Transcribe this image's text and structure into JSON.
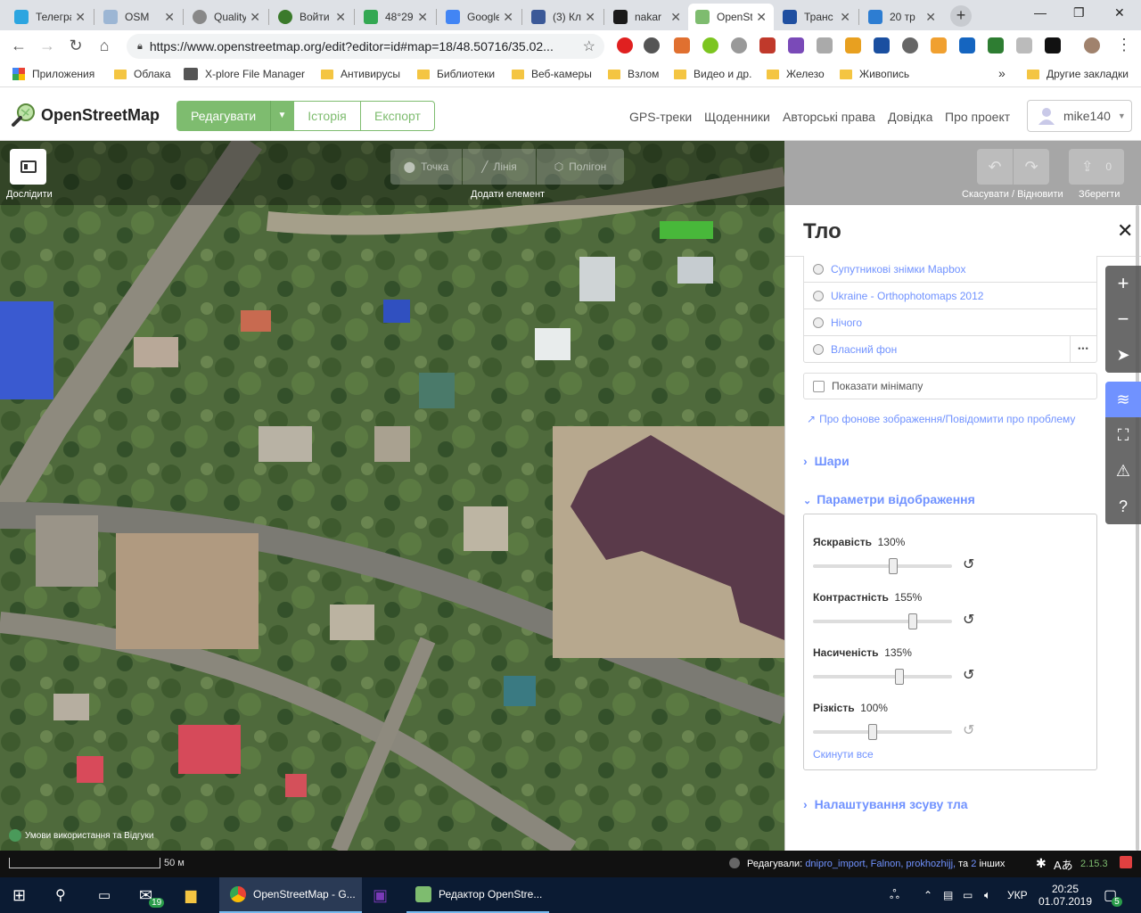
{
  "browser": {
    "tabs": [
      {
        "title": "Телеграм",
        "color": "#2ca5e0"
      },
      {
        "title": "OSM",
        "color": "#7ebc6f"
      },
      {
        "title": "Quality",
        "color": "#888888"
      },
      {
        "title": "Войти",
        "color": "#3b7a2b"
      },
      {
        "title": "48°29",
        "color": "#34a853"
      },
      {
        "title": "Google",
        "color": "#4285f4"
      },
      {
        "title": "(3) Кл",
        "color": "#3b5998"
      },
      {
        "title": "nakar",
        "color": "#1a1a1a"
      },
      {
        "title": "OpenStreetMap",
        "color": "#7ebc6f"
      },
      {
        "title": "Транс",
        "color": "#1f4fa0"
      },
      {
        "title": "20 тр",
        "color": "#2d7dd2"
      }
    ],
    "new_tab": "+",
    "url": "https://www.openstreetmap.org/edit?editor=id#map=18/48.50716/35.02...",
    "bookmarks": [
      {
        "label": "Приложения",
        "type": "apps"
      },
      {
        "label": "Облака",
        "type": "folder"
      },
      {
        "label": "X-plore File Manager",
        "type": "app"
      },
      {
        "label": "Антивирусы",
        "type": "folder"
      },
      {
        "label": "Библиотеки",
        "type": "folder"
      },
      {
        "label": "Веб-камеры",
        "type": "folder"
      },
      {
        "label": "Взлом",
        "type": "folder"
      },
      {
        "label": "Видео и др.",
        "type": "folder"
      },
      {
        "label": "Железо",
        "type": "folder"
      },
      {
        "label": "Живопись",
        "type": "folder"
      }
    ],
    "bookmarks_more": "»",
    "other_bookmarks": "Другие закладки"
  },
  "osm": {
    "brand": "OpenStreetMap",
    "edit": "Редагувати",
    "history": "Історія",
    "export": "Експорт",
    "nav": [
      "GPS-треки",
      "Щоденники",
      "Авторські права",
      "Довідка",
      "Про проект"
    ],
    "user": "mike140"
  },
  "editor": {
    "explore": "Дослідити",
    "point": "Точка",
    "line": "Лінія",
    "polygon": "Полігон",
    "add_feature": "Додати елемент",
    "undo_redo": "Скасувати / Відновити",
    "save": "Зберегти",
    "save_count": "0"
  },
  "panel": {
    "title": "Тло",
    "sources": [
      {
        "label": "Супутникові знімки Mapbox"
      },
      {
        "label": "Ukraine - Orthophotomaps 2012"
      },
      {
        "label": "Нічого"
      },
      {
        "label": "Власний фон"
      }
    ],
    "more_dots": "•••",
    "minimap": "Показати мінімапу",
    "about_link": "Про фонове зображення/Повідомити про проблему",
    "layers_section": "Шари",
    "display_section": "Параметри відображення",
    "sliders": [
      {
        "label": "Яскравість",
        "value": "130%",
        "fraction": 0.58
      },
      {
        "label": "Контрастність",
        "value": "155%",
        "fraction": 0.72
      },
      {
        "label": "Насиченість",
        "value": "135%",
        "fraction": 0.62
      },
      {
        "label": "Різкість",
        "value": "100%",
        "fraction": 0.43
      }
    ],
    "reset_all": "Скинути все",
    "offset_section": "Налаштування зсуву тла"
  },
  "footer": {
    "terms": "Умови використання та Відгуки",
    "scale": "50 м",
    "edited_by": "Редагували:",
    "editors": "dnipro_import, Falnon, prokhozhijj,",
    "and_others_prefix": "та",
    "others_count": "2",
    "others_suffix": "інших",
    "version": "2.15.3"
  },
  "taskbar": {
    "mail_badge": "19",
    "chrome_item": "OpenStreetMap - G...",
    "editor_item": "Редактор OpenStre...",
    "lang": "УКР",
    "time": "20:25",
    "date": "01.07.2019",
    "notif_count": "5"
  },
  "colors": {
    "accent_green": "#7ebc6f",
    "link_blue": "#7092ff"
  }
}
